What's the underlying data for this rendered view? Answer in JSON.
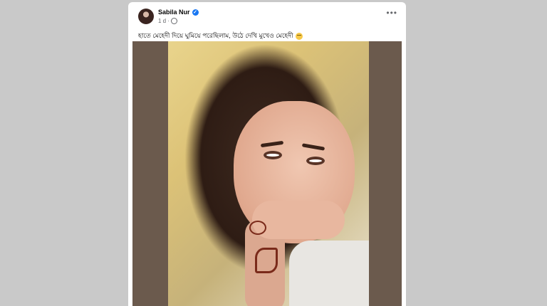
{
  "post": {
    "author": "Sabila Nur",
    "verified_icon": "verified-badge-icon",
    "time": "1 d",
    "privacy_icon": "globe-icon",
    "more_label": "•••",
    "caption": "হাতে মেহেদী দিয়ে ঘুমিয়ে পরেছিলাম, উঠে দেখি মুখেও মেহেদী",
    "emoji_icon": "smiling-face-emoji"
  }
}
